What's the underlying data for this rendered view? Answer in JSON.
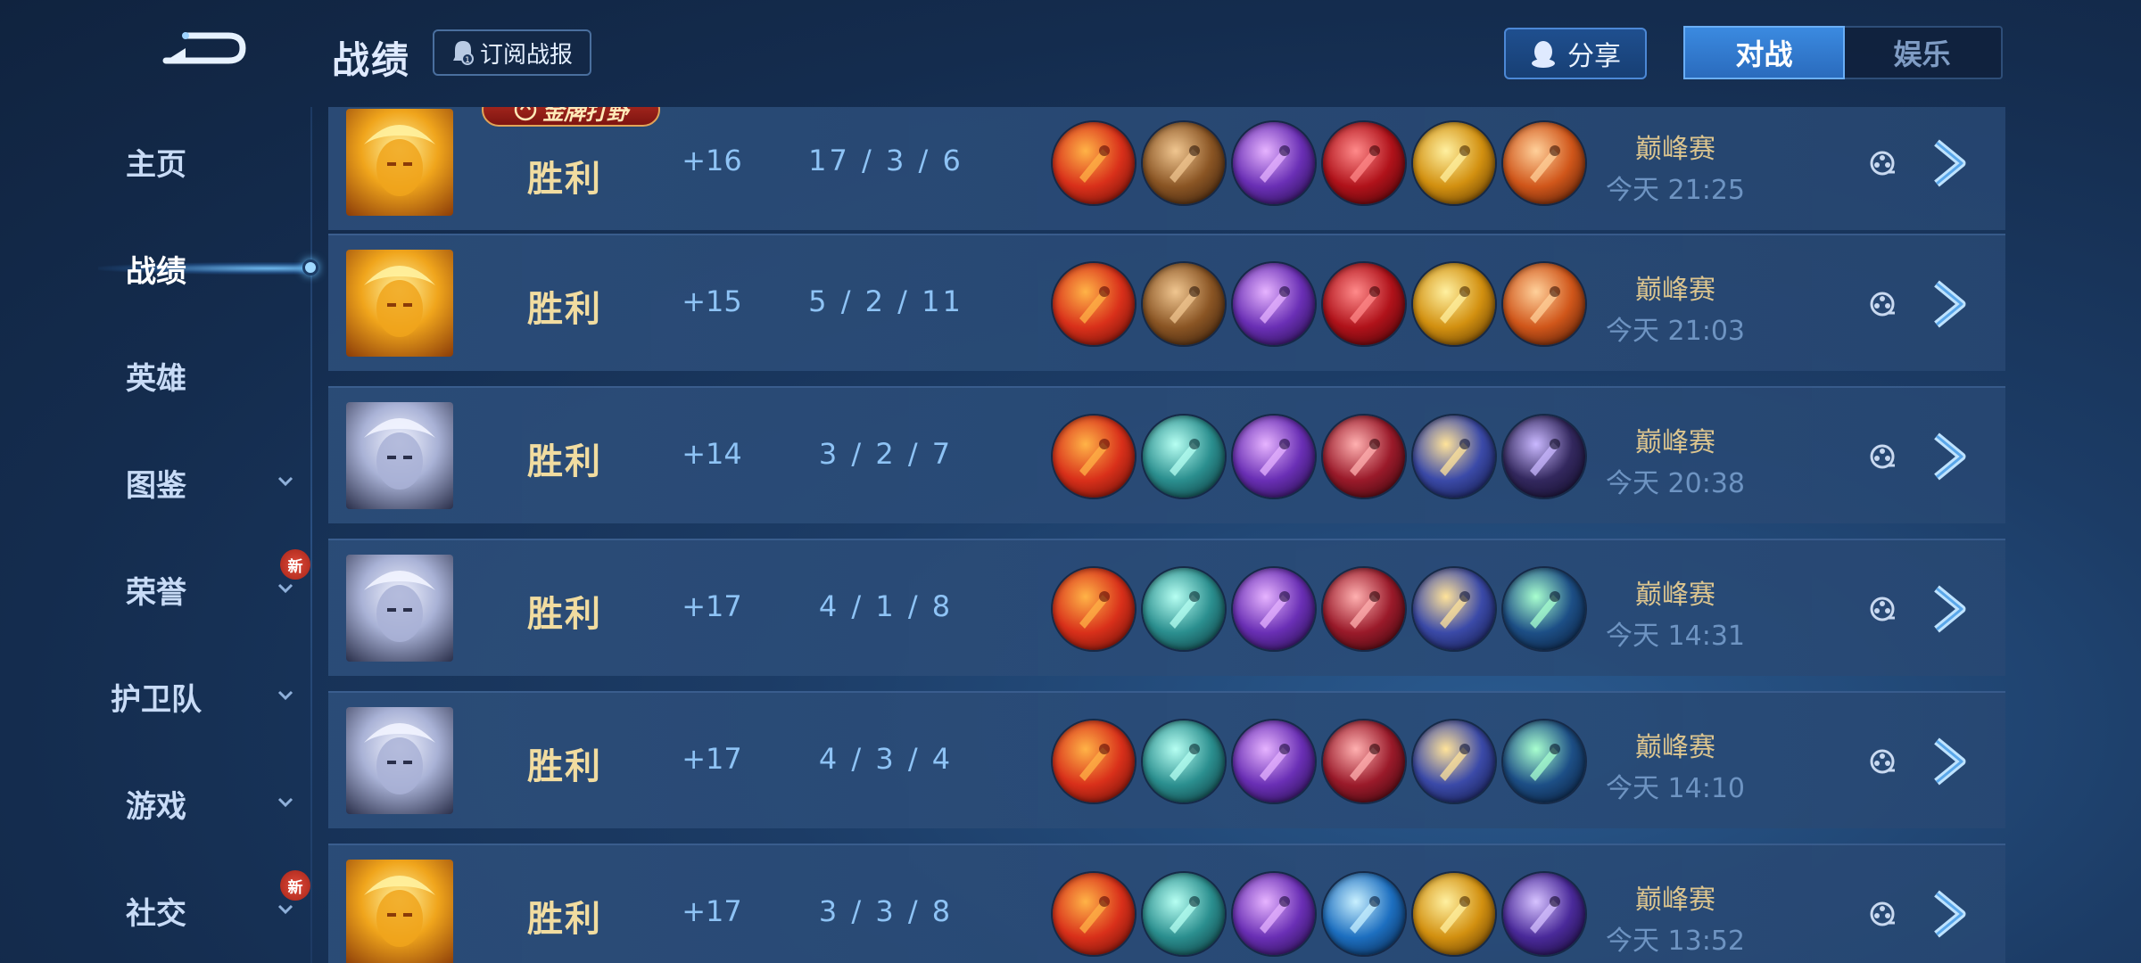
{
  "header": {
    "title": "战绩",
    "subscribe_label": "订阅战报",
    "share_label": "分享",
    "tabs": [
      {
        "label": "对战",
        "active": true
      },
      {
        "label": "娱乐",
        "active": false
      }
    ]
  },
  "sidebar": {
    "items": [
      {
        "label": "主页",
        "has_chevron": false,
        "new_badge": ""
      },
      {
        "label": "战绩",
        "has_chevron": false,
        "new_badge": "",
        "active": true
      },
      {
        "label": "英雄",
        "has_chevron": false,
        "new_badge": ""
      },
      {
        "label": "图鉴",
        "has_chevron": true,
        "new_badge": ""
      },
      {
        "label": "荣誉",
        "has_chevron": true,
        "new_badge": "新"
      },
      {
        "label": "护卫队",
        "has_chevron": true,
        "new_badge": ""
      },
      {
        "label": "游戏",
        "has_chevron": true,
        "new_badge": ""
      },
      {
        "label": "社交",
        "has_chevron": true,
        "new_badge": "新"
      }
    ]
  },
  "matches": [
    {
      "hero": "golden-warrior",
      "badge": "金牌打野",
      "result": "胜利",
      "points": "+16",
      "kda": "17 / 3 / 6",
      "items": [
        "red-dagger",
        "bronze-boots",
        "purple-axe",
        "red-gauntlet",
        "golden-mace",
        "flame-bow"
      ],
      "mode": "巅峰赛",
      "time": "今天 21:25"
    },
    {
      "hero": "golden-warrior",
      "badge": "",
      "result": "胜利",
      "points": "+15",
      "kda": "5 / 2 / 11",
      "items": [
        "red-dagger",
        "bronze-boots",
        "purple-axe",
        "red-gauntlet",
        "golden-mace",
        "flame-bow"
      ],
      "mode": "巅峰赛",
      "time": "今天 21:03"
    },
    {
      "hero": "silver-haired-swordsman",
      "badge": "",
      "result": "胜利",
      "points": "+14",
      "kda": "3 / 2 / 7",
      "items": [
        "red-dagger",
        "teal-boots",
        "purple-axe",
        "crimson-armor",
        "gold-web",
        "dark-cloak"
      ],
      "mode": "巅峰赛",
      "time": "今天 20:38"
    },
    {
      "hero": "silver-haired-swordsman",
      "badge": "",
      "result": "胜利",
      "points": "+17",
      "kda": "4 / 1 / 8",
      "items": [
        "red-dagger",
        "teal-boots",
        "purple-axe",
        "crimson-armor",
        "gold-web",
        "green-hood"
      ],
      "mode": "巅峰赛",
      "time": "今天 14:31"
    },
    {
      "hero": "silver-haired-swordsman",
      "badge": "",
      "result": "胜利",
      "points": "+17",
      "kda": "4 / 3 / 4",
      "items": [
        "red-dagger",
        "teal-boots",
        "purple-axe",
        "crimson-armor",
        "gold-web",
        "green-hood"
      ],
      "mode": "巅峰赛",
      "time": "今天 14:10"
    },
    {
      "hero": "golden-warrior",
      "badge": "",
      "result": "胜利",
      "points": "+17",
      "kda": "3 / 3 / 8",
      "items": [
        "red-dagger",
        "teal-boots",
        "purple-axe",
        "blue-sword",
        "golden-mace",
        "violet-spear"
      ],
      "mode": "巅峰赛",
      "time": "今天 13:52"
    }
  ],
  "colors": {
    "result_gold": "#f1dca0",
    "stat_blue": "#8ec3f5",
    "accent": "#3b8ae0"
  }
}
